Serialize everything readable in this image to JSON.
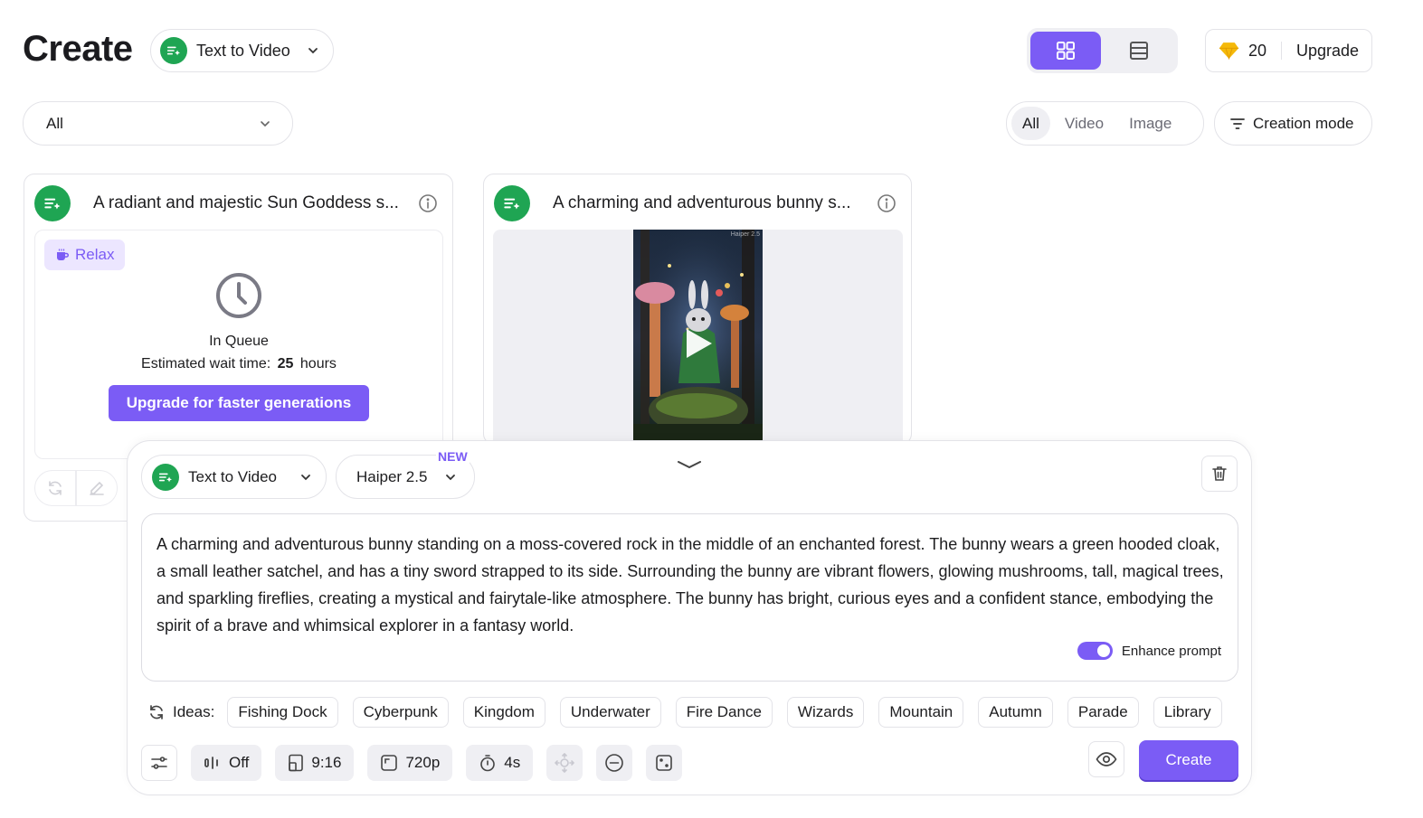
{
  "header": {
    "title": "Create",
    "mode_label": "Text to Video",
    "credits": "20",
    "upgrade_label": "Upgrade"
  },
  "filters": {
    "selected": "All",
    "type_tabs": [
      "All",
      "Video",
      "Image"
    ],
    "creation_mode_label": "Creation mode"
  },
  "cards": [
    {
      "title": "A radiant and majestic Sun Goddess s...",
      "badge": "Relax",
      "status": "In Queue",
      "wait_prefix": "Estimated wait time:",
      "wait_value": "25",
      "wait_unit": "hours",
      "upgrade_button": "Upgrade for faster generations"
    },
    {
      "title": "A charming and adventurous bunny s...",
      "watermark": "Haiper 2.5"
    }
  ],
  "panel": {
    "mode_label": "Text to Video",
    "model_label": "Haiper 2.5",
    "new_badge": "NEW",
    "prompt": "A charming and adventurous bunny standing on a moss-covered rock in the middle of an enchanted forest. The bunny wears a green hooded cloak, a small leather satchel, and has a tiny sword strapped to its side. Surrounding the bunny are vibrant flowers, glowing mushrooms, tall, magical trees, and sparkling fireflies, creating a mystical and fairytale-like atmosphere. The bunny has bright, curious eyes and a confident stance, embodying the spirit of a brave and whimsical explorer in a fantasy world.",
    "enhance_label": "Enhance prompt",
    "enhance_on": true,
    "ideas_label": "Ideas:",
    "ideas": [
      "Fishing Dock",
      "Cyberpunk",
      "Kingdom",
      "Underwater",
      "Fire Dance",
      "Wizards",
      "Mountain",
      "Autumn",
      "Parade",
      "Library"
    ],
    "toolbar": {
      "audio": "Off",
      "aspect": "9:16",
      "resolution": "720p",
      "duration": "4s"
    },
    "create_label": "Create"
  },
  "colors": {
    "accent": "#7b5cf5",
    "brand_green": "#1fa553",
    "gem": "#f5b90a"
  }
}
